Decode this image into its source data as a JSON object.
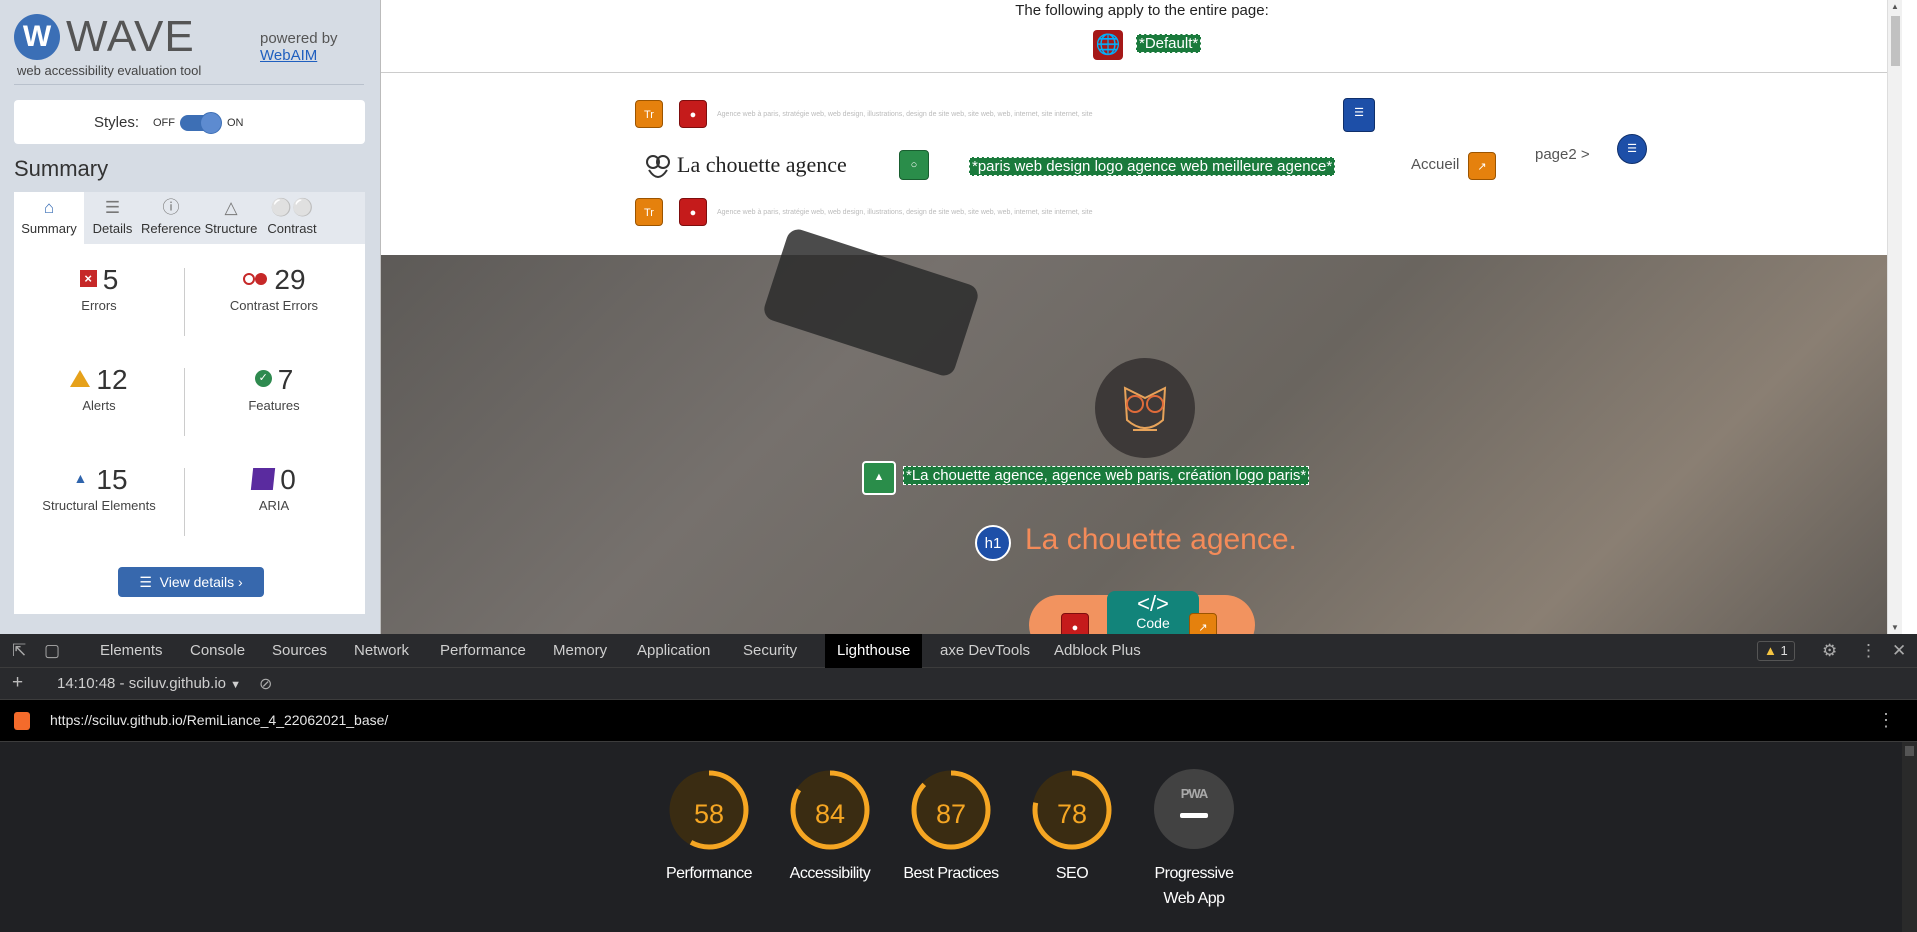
{
  "wave": {
    "logo_letter": "W",
    "name": "WAVE",
    "tagline": "web accessibility evaluation tool",
    "powered_by": "powered by",
    "webaim_link": "WebAIM",
    "styles_label": "Styles:",
    "styles_off": "OFF",
    "styles_on": "ON",
    "summary_title": "Summary",
    "tabs": [
      {
        "label": "Summary",
        "icon": "home-icon",
        "active": true
      },
      {
        "label": "Details",
        "icon": "list-icon",
        "active": false
      },
      {
        "label": "Reference",
        "icon": "info-icon",
        "active": false
      },
      {
        "label": "Structure",
        "icon": "structure-icon",
        "active": false
      },
      {
        "label": "Contrast",
        "icon": "contrast-icon",
        "active": false
      }
    ],
    "stats": {
      "errors": {
        "value": "5",
        "label": "Errors"
      },
      "contrast_errors": {
        "value": "29",
        "label": "Contrast Errors"
      },
      "alerts": {
        "value": "12",
        "label": "Alerts"
      },
      "features": {
        "value": "7",
        "label": "Features"
      },
      "structural": {
        "value": "15",
        "label": "Structural Elements"
      },
      "aria": {
        "value": "0",
        "label": "ARIA"
      }
    },
    "view_details": "View details ›"
  },
  "preview": {
    "apply_text": "The following apply to the entire page:",
    "default_tag": "*Default*",
    "tiny_text": "Agence web à paris, stratégie web, web design, illustrations, design de site web, site web, web, internet, site internet, site",
    "brand_name": "La chouette agence",
    "logo_alt": "*paris web design logo agence web meilleure agence*",
    "nav_home": "Accueil",
    "nav_page2": "page2 >",
    "hero_alt": "*La chouette agence, agence web paris, création logo paris*",
    "h1_badge": "h1",
    "hero_title": "La chouette agence.",
    "code_symbol": "</>",
    "code_label": "Code",
    "tr_label": "Tr"
  },
  "devtools": {
    "tabs": [
      "Elements",
      "Console",
      "Sources",
      "Network",
      "Performance",
      "Memory",
      "Application",
      "Security",
      "Lighthouse",
      "axe DevTools",
      "Adblock Plus"
    ],
    "active_tab": "Lighthouse",
    "warning_count": "1",
    "report_time": "14:10:48 - sciluv.github.io",
    "url": "https://sciluv.github.io/RemiLiance_4_22062021_base/",
    "accent": "#f5a623"
  },
  "lighthouse": {
    "scores": [
      {
        "value": 58,
        "label": "Performance"
      },
      {
        "value": 84,
        "label": "Accessibility"
      },
      {
        "value": 87,
        "label": "Best Practices"
      },
      {
        "value": 78,
        "label": "SEO"
      }
    ],
    "pwa": {
      "badge": "PWA",
      "label_line1": "Progressive",
      "label_line2": "Web App"
    }
  }
}
